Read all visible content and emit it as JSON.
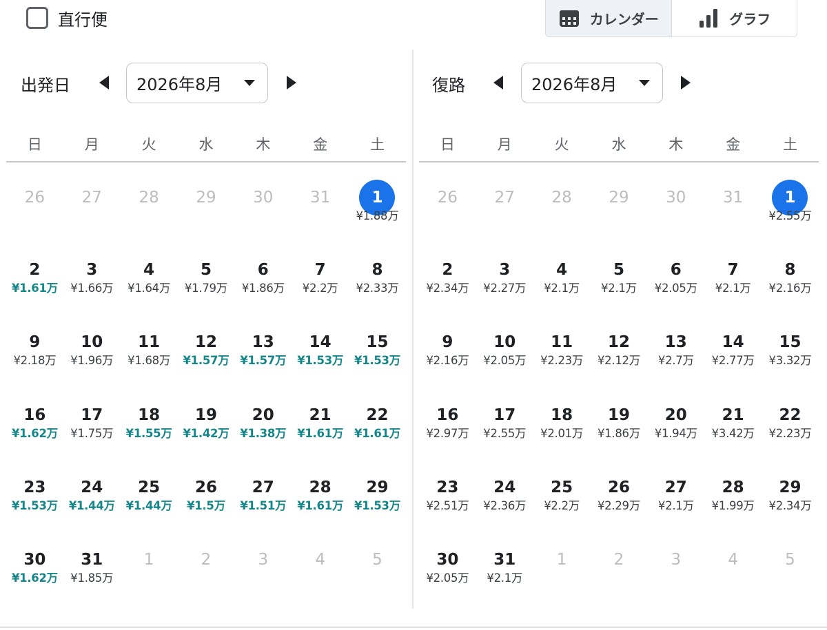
{
  "direct_flight": {
    "label": "直行便",
    "checked": false
  },
  "view_tabs": [
    {
      "label": "カレンダー",
      "icon": "calendar-icon",
      "active": true
    },
    {
      "label": "グラフ",
      "icon": "bar-chart-icon",
      "active": false
    }
  ],
  "weekdays": [
    "日",
    "月",
    "火",
    "水",
    "木",
    "金",
    "土"
  ],
  "colors": {
    "selected": "#1a73e8",
    "cheap_price": "#15868a",
    "muted_day": "#bdbdbd"
  },
  "calendars": [
    {
      "key": "outbound",
      "label": "出発日",
      "month": "2026年8月",
      "cells": [
        {
          "day": "26",
          "price": "",
          "muted": true
        },
        {
          "day": "27",
          "price": "",
          "muted": true
        },
        {
          "day": "28",
          "price": "",
          "muted": true
        },
        {
          "day": "29",
          "price": "",
          "muted": true
        },
        {
          "day": "30",
          "price": "",
          "muted": true
        },
        {
          "day": "31",
          "price": "",
          "muted": true
        },
        {
          "day": "1",
          "price": "¥1.88万",
          "selected": true
        },
        {
          "day": "2",
          "price": "¥1.61万",
          "cheap": true
        },
        {
          "day": "3",
          "price": "¥1.66万"
        },
        {
          "day": "4",
          "price": "¥1.64万"
        },
        {
          "day": "5",
          "price": "¥1.79万"
        },
        {
          "day": "6",
          "price": "¥1.86万"
        },
        {
          "day": "7",
          "price": "¥2.2万"
        },
        {
          "day": "8",
          "price": "¥2.33万"
        },
        {
          "day": "9",
          "price": "¥2.18万"
        },
        {
          "day": "10",
          "price": "¥1.96万"
        },
        {
          "day": "11",
          "price": "¥1.68万"
        },
        {
          "day": "12",
          "price": "¥1.57万",
          "cheap": true
        },
        {
          "day": "13",
          "price": "¥1.57万",
          "cheap": true
        },
        {
          "day": "14",
          "price": "¥1.53万",
          "cheap": true
        },
        {
          "day": "15",
          "price": "¥1.53万",
          "cheap": true
        },
        {
          "day": "16",
          "price": "¥1.62万",
          "cheap": true
        },
        {
          "day": "17",
          "price": "¥1.75万"
        },
        {
          "day": "18",
          "price": "¥1.55万",
          "cheap": true
        },
        {
          "day": "19",
          "price": "¥1.42万",
          "cheap": true
        },
        {
          "day": "20",
          "price": "¥1.38万",
          "cheap": true
        },
        {
          "day": "21",
          "price": "¥1.61万",
          "cheap": true
        },
        {
          "day": "22",
          "price": "¥1.61万",
          "cheap": true
        },
        {
          "day": "23",
          "price": "¥1.53万",
          "cheap": true
        },
        {
          "day": "24",
          "price": "¥1.44万",
          "cheap": true
        },
        {
          "day": "25",
          "price": "¥1.44万",
          "cheap": true
        },
        {
          "day": "26",
          "price": "¥1.5万",
          "cheap": true
        },
        {
          "day": "27",
          "price": "¥1.51万",
          "cheap": true
        },
        {
          "day": "28",
          "price": "¥1.61万",
          "cheap": true
        },
        {
          "day": "29",
          "price": "¥1.53万",
          "cheap": true
        },
        {
          "day": "30",
          "price": "¥1.62万",
          "cheap": true
        },
        {
          "day": "31",
          "price": "¥1.85万"
        },
        {
          "day": "1",
          "price": "",
          "muted": true
        },
        {
          "day": "2",
          "price": "",
          "muted": true
        },
        {
          "day": "3",
          "price": "",
          "muted": true
        },
        {
          "day": "4",
          "price": "",
          "muted": true
        },
        {
          "day": "5",
          "price": "",
          "muted": true
        }
      ]
    },
    {
      "key": "return",
      "label": "復路",
      "month": "2026年8月",
      "cells": [
        {
          "day": "26",
          "price": "",
          "muted": true
        },
        {
          "day": "27",
          "price": "",
          "muted": true
        },
        {
          "day": "28",
          "price": "",
          "muted": true
        },
        {
          "day": "29",
          "price": "",
          "muted": true
        },
        {
          "day": "30",
          "price": "",
          "muted": true
        },
        {
          "day": "31",
          "price": "",
          "muted": true
        },
        {
          "day": "1",
          "price": "¥2.55万",
          "selected": true
        },
        {
          "day": "2",
          "price": "¥2.34万"
        },
        {
          "day": "3",
          "price": "¥2.27万"
        },
        {
          "day": "4",
          "price": "¥2.1万"
        },
        {
          "day": "5",
          "price": "¥2.1万"
        },
        {
          "day": "6",
          "price": "¥2.05万"
        },
        {
          "day": "7",
          "price": "¥2.1万"
        },
        {
          "day": "8",
          "price": "¥2.16万"
        },
        {
          "day": "9",
          "price": "¥2.16万"
        },
        {
          "day": "10",
          "price": "¥2.05万"
        },
        {
          "day": "11",
          "price": "¥2.23万"
        },
        {
          "day": "12",
          "price": "¥2.12万"
        },
        {
          "day": "13",
          "price": "¥2.7万"
        },
        {
          "day": "14",
          "price": "¥2.77万"
        },
        {
          "day": "15",
          "price": "¥3.32万"
        },
        {
          "day": "16",
          "price": "¥2.97万"
        },
        {
          "day": "17",
          "price": "¥2.55万"
        },
        {
          "day": "18",
          "price": "¥2.01万"
        },
        {
          "day": "19",
          "price": "¥1.86万"
        },
        {
          "day": "20",
          "price": "¥1.94万"
        },
        {
          "day": "21",
          "price": "¥3.42万"
        },
        {
          "day": "22",
          "price": "¥2.23万"
        },
        {
          "day": "23",
          "price": "¥2.51万"
        },
        {
          "day": "24",
          "price": "¥2.36万"
        },
        {
          "day": "25",
          "price": "¥2.2万"
        },
        {
          "day": "26",
          "price": "¥2.29万"
        },
        {
          "day": "27",
          "price": "¥2.1万"
        },
        {
          "day": "28",
          "price": "¥1.99万"
        },
        {
          "day": "29",
          "price": "¥2.34万"
        },
        {
          "day": "30",
          "price": "¥2.05万"
        },
        {
          "day": "31",
          "price": "¥2.1万"
        },
        {
          "day": "1",
          "price": "",
          "muted": true
        },
        {
          "day": "2",
          "price": "",
          "muted": true
        },
        {
          "day": "3",
          "price": "",
          "muted": true
        },
        {
          "day": "4",
          "price": "",
          "muted": true
        },
        {
          "day": "5",
          "price": "",
          "muted": true
        }
      ]
    }
  ]
}
